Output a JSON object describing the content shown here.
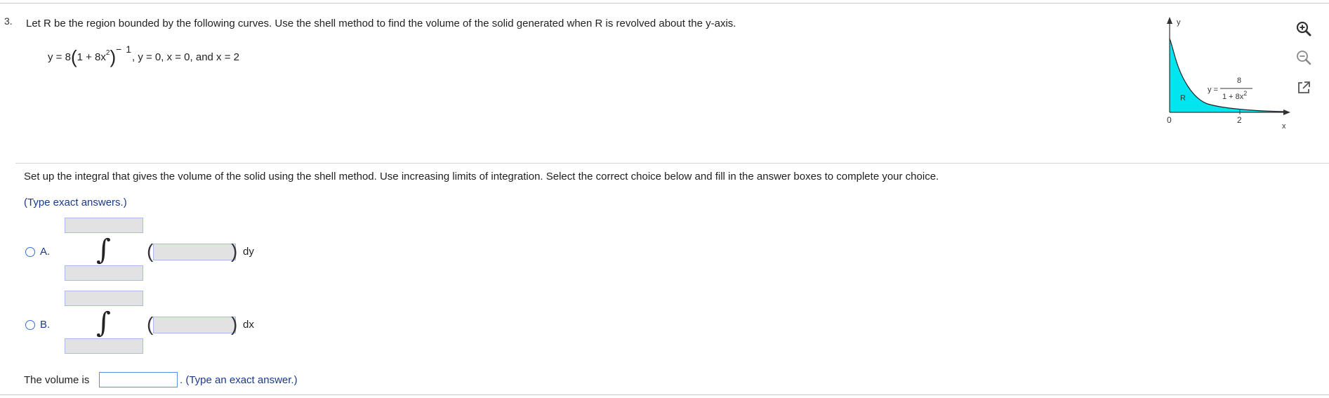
{
  "question": {
    "number": "3.",
    "prompt": "Let R be the region bounded by the following curves. Use the shell method to find the volume of the solid generated when R is revolved about the y-axis.",
    "curves": {
      "f_prefix": "y = 8",
      "f_inner": "1 + 8x",
      "f_inner_exp": "2",
      "f_exp": "− 1",
      "rest": ", y = 0, x = 0, and x = 2"
    }
  },
  "graph": {
    "y_axis_label": "y",
    "x_axis_label": "x",
    "region_label": "R",
    "function_lhs": "y =",
    "function_numerator": "8",
    "function_denominator": "1 + 8x",
    "function_denominator_exp": "2",
    "x_ticks": [
      "0",
      "2"
    ],
    "fill_color": "#00e5ef"
  },
  "instructions": {
    "setup": "Set up the integral that gives the volume of the solid using the shell method. Use increasing limits of integration. Select the correct choice below and fill in the answer boxes to complete your choice.",
    "hint": "(Type exact answers.)"
  },
  "choices": [
    {
      "label": "A.",
      "differential": "dy"
    },
    {
      "label": "B.",
      "differential": "dx"
    }
  ],
  "answer": {
    "label": "The volume is",
    "suffix": ". (Type an exact answer.)"
  },
  "tools": [
    "zoom-in-icon",
    "zoom-out-icon",
    "popout-icon"
  ],
  "colors": {
    "accent": "#1a3a8a",
    "input_border": "#5b8ce6",
    "radio": "#3a6fd8"
  }
}
